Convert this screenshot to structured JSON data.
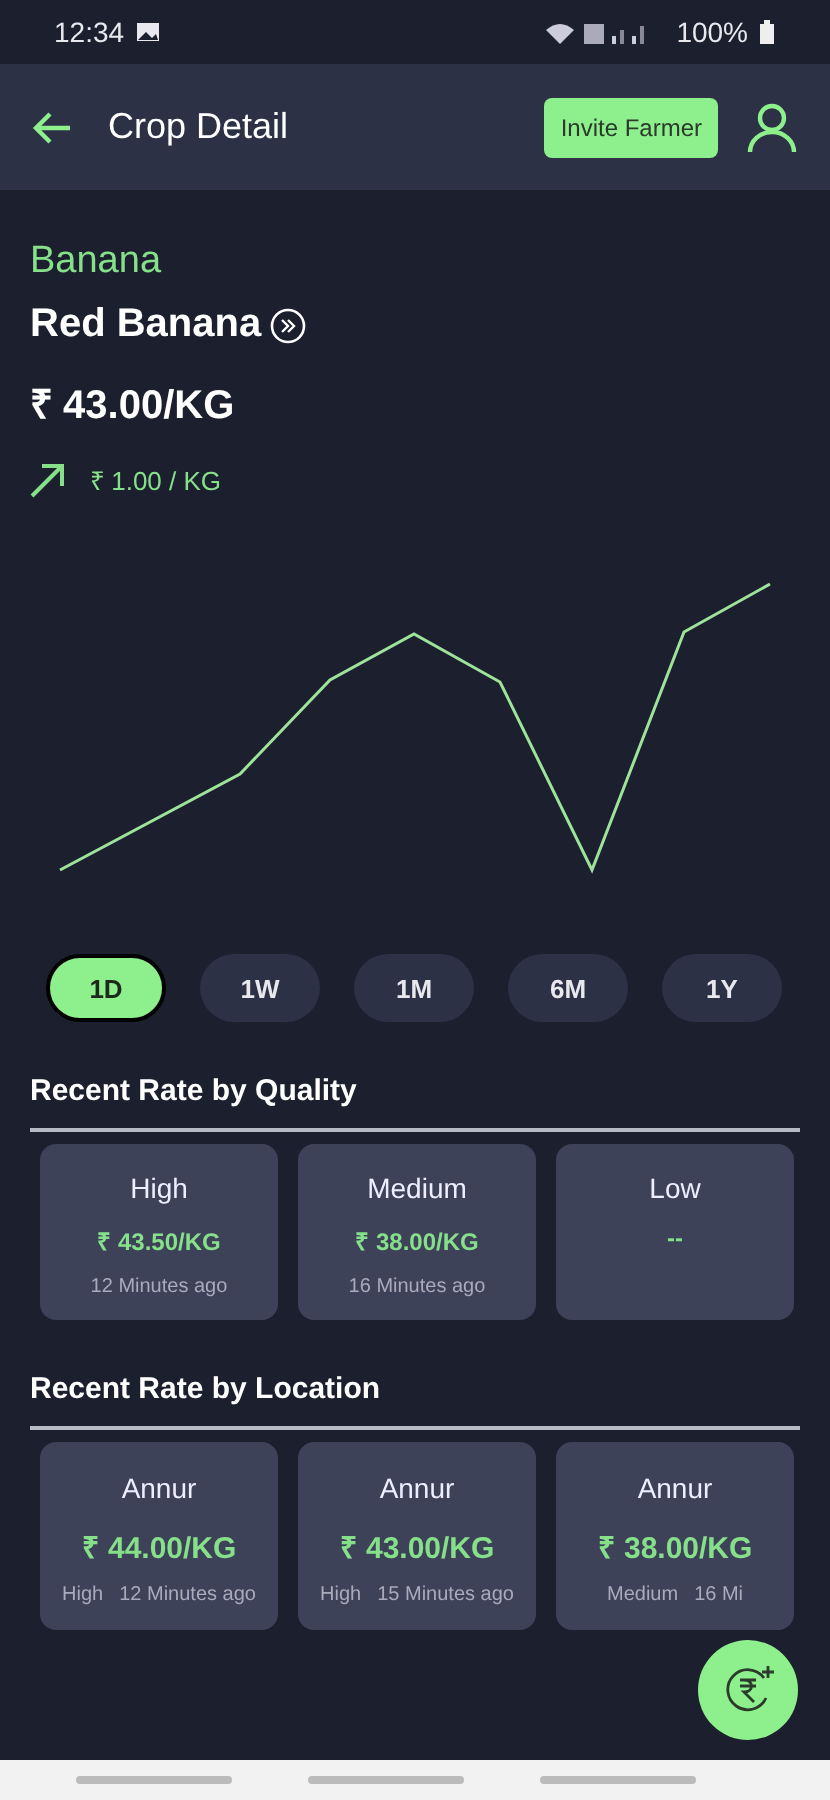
{
  "status_bar": {
    "time": "12:34",
    "battery": "100%"
  },
  "app_bar": {
    "title": "Crop Detail",
    "invite_button": "Invite Farmer"
  },
  "crop": {
    "category": "Banana",
    "variety": "Red Banana",
    "price": "₹ 43.00/KG",
    "change": "₹ 1.00 / KG",
    "rising": true
  },
  "periods": [
    {
      "label": "1D",
      "selected": true
    },
    {
      "label": "1W",
      "selected": false
    },
    {
      "label": "1M",
      "selected": false
    },
    {
      "label": "6M",
      "selected": false
    },
    {
      "label": "1Y",
      "selected": false
    }
  ],
  "quality_section": {
    "title": "Recent Rate by Quality",
    "cards": [
      {
        "grade": "High",
        "price": "₹ 43.50/KG",
        "time": "12 Minutes ago"
      },
      {
        "grade": "Medium",
        "price": "₹ 38.00/KG",
        "time": "16 Minutes ago"
      },
      {
        "grade": "Low",
        "price": "--"
      }
    ]
  },
  "location_section": {
    "title": "Recent Rate by Location",
    "cards": [
      {
        "location": "Annur",
        "price": "₹ 44.00/KG",
        "grade": "High",
        "time": "12 Minutes ago"
      },
      {
        "location": "Annur",
        "price": "₹ 43.00/KG",
        "grade": "High",
        "time": "15 Minutes ago"
      },
      {
        "location": "Annur",
        "price": "₹ 38.00/KG",
        "grade": "Medium",
        "time": "16 Mi"
      }
    ]
  }
}
